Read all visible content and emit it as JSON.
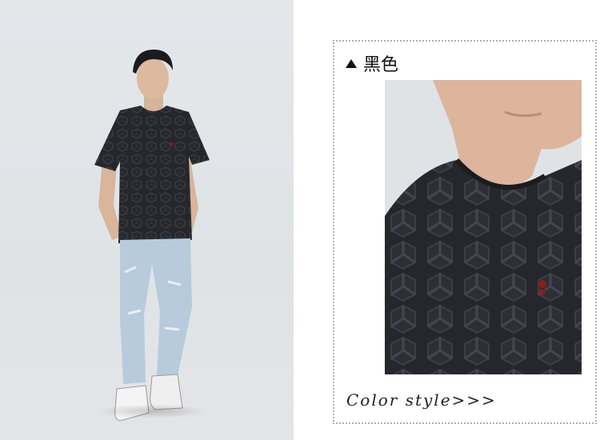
{
  "color_section": {
    "marker_icon": "triangle-up-icon",
    "label": "黑色"
  },
  "tagline": "Color style>>>",
  "colors": {
    "background": "#ffffff",
    "photo_background": "#e0e4e7",
    "shirt": "#26272c",
    "jeans": "#b7cbdd",
    "emblem": "#8b1c1c",
    "frame_border": "#b3b3b3"
  }
}
